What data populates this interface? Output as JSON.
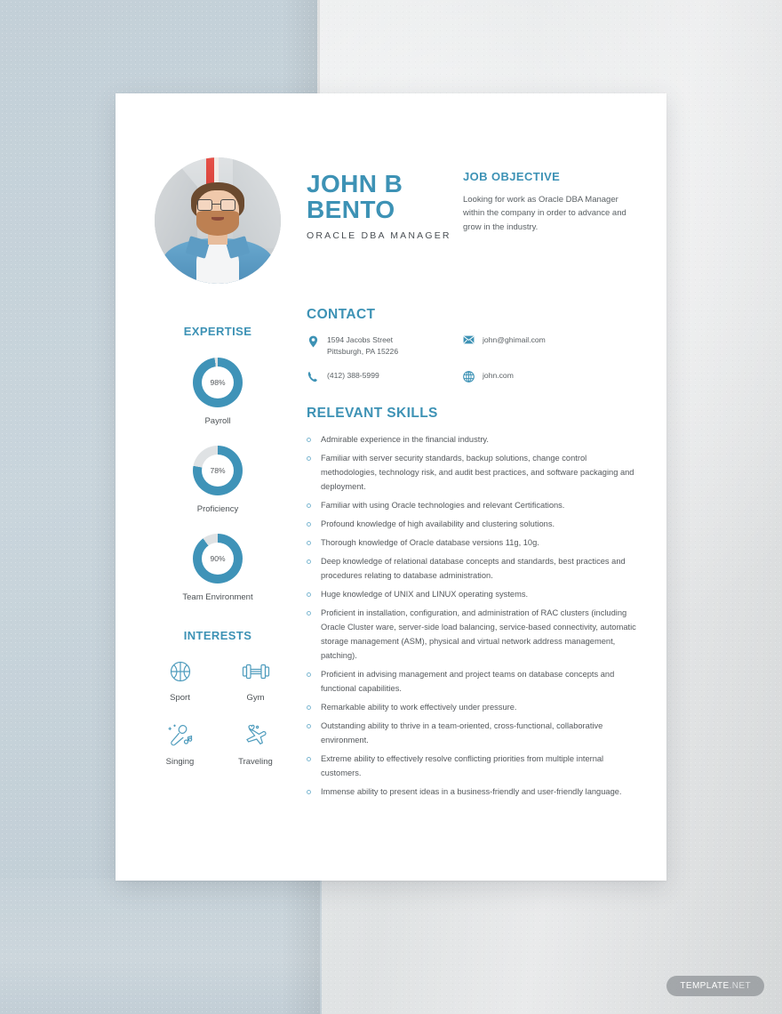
{
  "document": {
    "type": "resume-template",
    "watermark_bold": "TEMPLATE",
    "watermark_light": ".NET"
  },
  "header": {
    "name": "JOHN B BENTO",
    "name_line1": "JOHN B",
    "name_line2": "BENTO",
    "job_title": "ORACLE DBA MANAGER",
    "photo_alt": "profile-photo"
  },
  "objective": {
    "heading": "JOB OBJECTIVE",
    "text": "Looking for work as Oracle DBA Manager within the company in order to advance and grow in the industry."
  },
  "expertise": {
    "heading": "EXPERTISE",
    "items": [
      {
        "label": "Payroll",
        "percent": 98,
        "percent_label": "98%"
      },
      {
        "label": "Proficiency",
        "percent": 78,
        "percent_label": "78%"
      },
      {
        "label": "Team Environment",
        "percent": 90,
        "percent_label": "90%"
      }
    ]
  },
  "interests": {
    "heading": "INTERESTS",
    "items": [
      {
        "label": "Sport",
        "icon": "basketball-icon"
      },
      {
        "label": "Gym",
        "icon": "dumbbell-icon"
      },
      {
        "label": "Singing",
        "icon": "microphone-icon"
      },
      {
        "label": "Traveling",
        "icon": "airplane-icon"
      }
    ]
  },
  "contact": {
    "heading": "CONTACT",
    "address_line1": "1594 Jacobs Street",
    "address_line2": "Pittsburgh, PA 15226",
    "phone": "(412) 388-5999",
    "email": "john@ghimail.com",
    "website": "john.com"
  },
  "skills": {
    "heading": "RELEVANT SKILLS",
    "items": [
      "Admirable experience in the financial industry.",
      "Familiar with server security standards, backup solutions, change control methodologies, technology risk, and audit best practices, and software packaging and deployment.",
      "Familiar with using Oracle technologies and relevant Certifications.",
      "Profound knowledge of high availability and clustering solutions.",
      "Thorough knowledge of Oracle database versions 11g, 10g.",
      "Deep knowledge of relational database concepts and standards, best practices and procedures relating to database administration.",
      "Huge knowledge of UNIX and LINUX operating systems.",
      "Proficient in installation, configuration, and administration of RAC clusters (including Oracle Cluster ware, server-side load balancing, service-based connectivity, automatic storage management (ASM), physical and virtual network address management, patching).",
      "Proficient in advising management and project teams on database concepts and functional capabilities.",
      "Remarkable ability to work effectively under pressure.",
      "Outstanding ability to thrive in a team-oriented, cross-functional, collaborative environment.",
      "Extreme ability to effectively resolve conflicting priorities from multiple internal customers.",
      "Immense ability to present ideas in a business-friendly and user-friendly language."
    ]
  },
  "colors": {
    "accent": "#3d92b5",
    "donut_fill": "#3f93b8",
    "donut_track": "#dfe2e4",
    "body_text": "#55595d",
    "paper": "#ffffff",
    "bg_left": "#c6d2d9",
    "bg_right": "#e2e5e6"
  }
}
